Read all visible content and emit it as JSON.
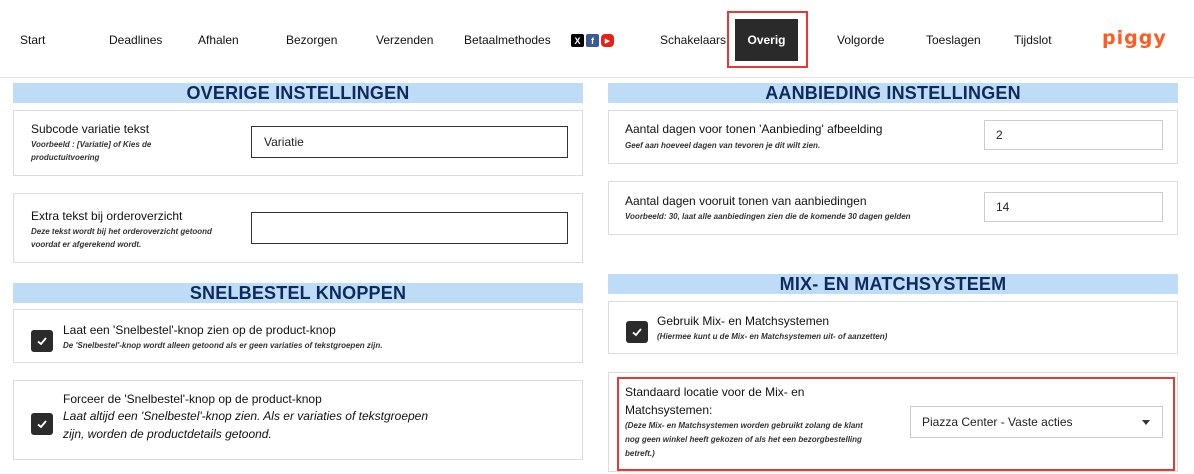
{
  "nav": {
    "items": [
      "Start",
      "Deadlines",
      "Afhalen",
      "Bezorgen",
      "Verzenden",
      "Betaalmethodes",
      "Schakelaars",
      "Overig",
      "Volgorde",
      "Toeslagen",
      "Tijdslot"
    ],
    "active": "Overig",
    "social": {
      "x": "X",
      "facebook": "f",
      "youtube": "▶"
    },
    "logo": "piggy",
    "logo_color": "#ff5a1f"
  },
  "overige": {
    "header": "OVERIGE INSTELLINGEN",
    "subcode": {
      "label": "Subcode variatie tekst",
      "hint_line1": "Voorbeeld : [Variatie] of Kies de",
      "hint_line2": "productuitvoering",
      "value": "Variatie"
    },
    "extra_tekst": {
      "label": "Extra tekst bij orderoverzicht",
      "hint_line1": "Deze tekst wordt bij het orderoverzicht getoond",
      "hint_line2": "voordat er afgerekend wordt.",
      "value": ""
    }
  },
  "snelbestel": {
    "header": "SNELBESTEL KNOPPEN",
    "show": {
      "label": "Laat een 'Snelbestel'-knop zien op de product-knop",
      "hint": "De 'Snelbestel'-knop wordt alleen getoond als er geen variaties of tekstgroepen zijn.",
      "checked": true
    },
    "force": {
      "label": "Forceer de 'Snelbestel'-knop op de product-knop",
      "hint_line1": "Laat altijd een 'Snelbestel'-knop zien. Als er variaties of tekstgroepen",
      "hint_line2": "zijn, worden de productdetails getoond.",
      "checked": true
    }
  },
  "aanbieding": {
    "header": "AANBIEDING INSTELLINGEN",
    "dagen_tonen": {
      "label": "Aantal dagen voor tonen 'Aanbieding' afbeelding",
      "hint": "Geef aan hoeveel dagen van tevoren je dit wilt zien.",
      "value": "2"
    },
    "dagen_vooruit": {
      "label": "Aantal dagen vooruit tonen van aanbiedingen",
      "hint": "Voorbeeld: 30, laat alle aanbiedingen zien die de komende 30 dagen gelden",
      "value": "14"
    }
  },
  "mixmatch": {
    "header": "MIX- EN MATCHSYSTEEM",
    "gebruik": {
      "label": "Gebruik Mix- en Matchsystemen",
      "hint": "(Hiermee kunt u de Mix- en Matchsystemen uit- of aanzetten)",
      "checked": true
    },
    "locatie": {
      "label_line1": "Standaard locatie voor de Mix- en",
      "label_line2": "Matchsystemen:",
      "hint_line1": "(Deze Mix- en Matchsystemen worden gebruikt zolang de klant",
      "hint_line2": "nog geen winkel heeft gekozen of als het een bezorgbestelling",
      "hint_line3": "betreft.)",
      "selected": "Piazza Center - Vaste acties"
    }
  },
  "colors": {
    "header_bg": "#bfdcf7",
    "header_text": "#0d2a5e",
    "highlight": "#e53935",
    "active_tab": "#2a2a2a"
  }
}
